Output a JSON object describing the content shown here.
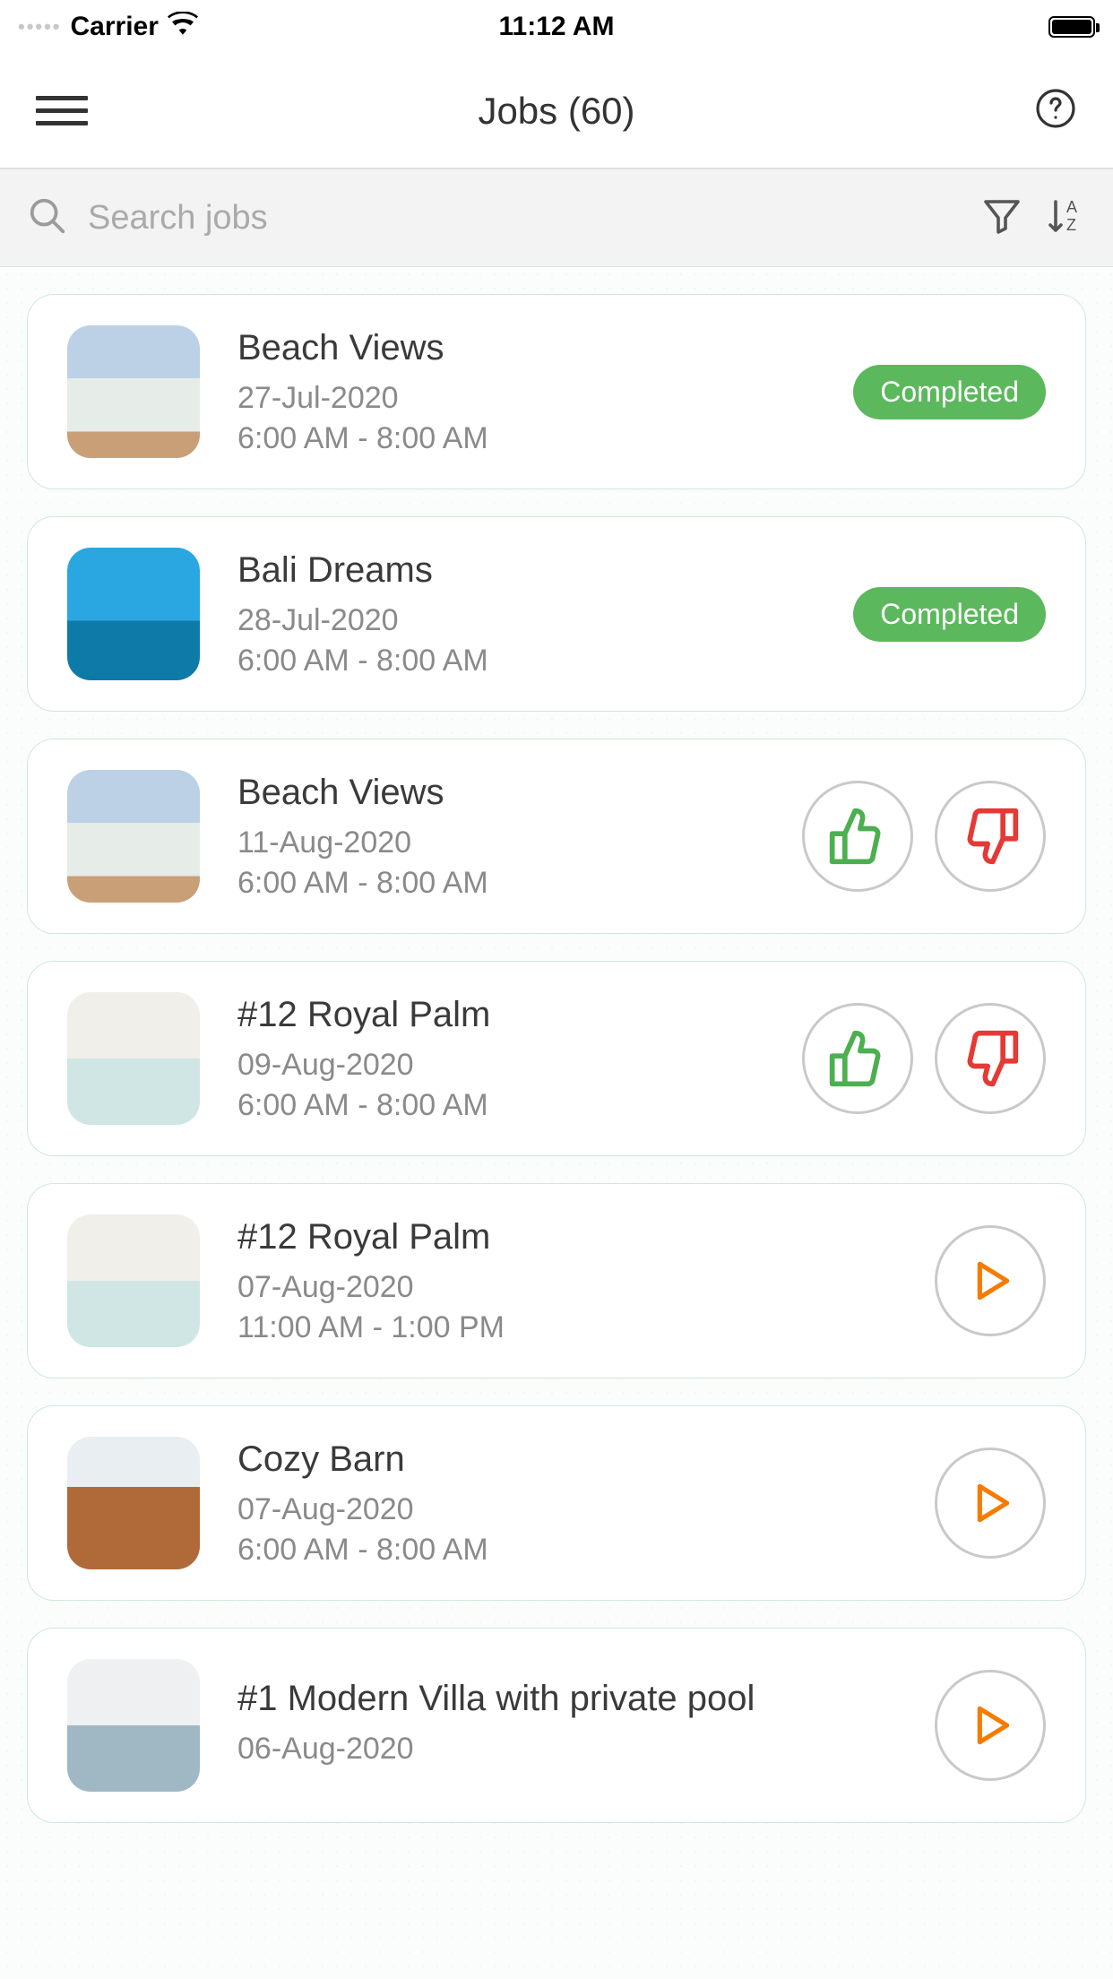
{
  "status": {
    "carrier": "Carrier",
    "time": "11:12 AM"
  },
  "nav": {
    "title": "Jobs (60)"
  },
  "search": {
    "placeholder": "Search jobs"
  },
  "badge_completed": "Completed",
  "jobs": [
    {
      "title": "Beach Views",
      "date": "27-Jul-2020",
      "time": "6:00 AM - 8:00 AM",
      "status": "completed",
      "thumb": "t-beach"
    },
    {
      "title": "Bali Dreams",
      "date": "28-Jul-2020",
      "time": "6:00 AM - 8:00 AM",
      "status": "completed",
      "thumb": "t-bali"
    },
    {
      "title": "Beach Views",
      "date": "11-Aug-2020",
      "time": "6:00 AM - 8:00 AM",
      "status": "vote",
      "thumb": "t-beach"
    },
    {
      "title": "#12 Royal Palm",
      "date": "09-Aug-2020",
      "time": "6:00 AM - 8:00 AM",
      "status": "vote",
      "thumb": "t-room"
    },
    {
      "title": "#12 Royal Palm",
      "date": "07-Aug-2020",
      "time": "11:00 AM - 1:00 PM",
      "status": "play",
      "thumb": "t-room"
    },
    {
      "title": "Cozy Barn",
      "date": "07-Aug-2020",
      "time": "6:00 AM - 8:00 AM",
      "status": "play",
      "thumb": "t-barn"
    },
    {
      "title": "#1 Modern Villa with private pool",
      "date": "06-Aug-2020",
      "time": "",
      "status": "play",
      "thumb": "t-villa"
    }
  ]
}
